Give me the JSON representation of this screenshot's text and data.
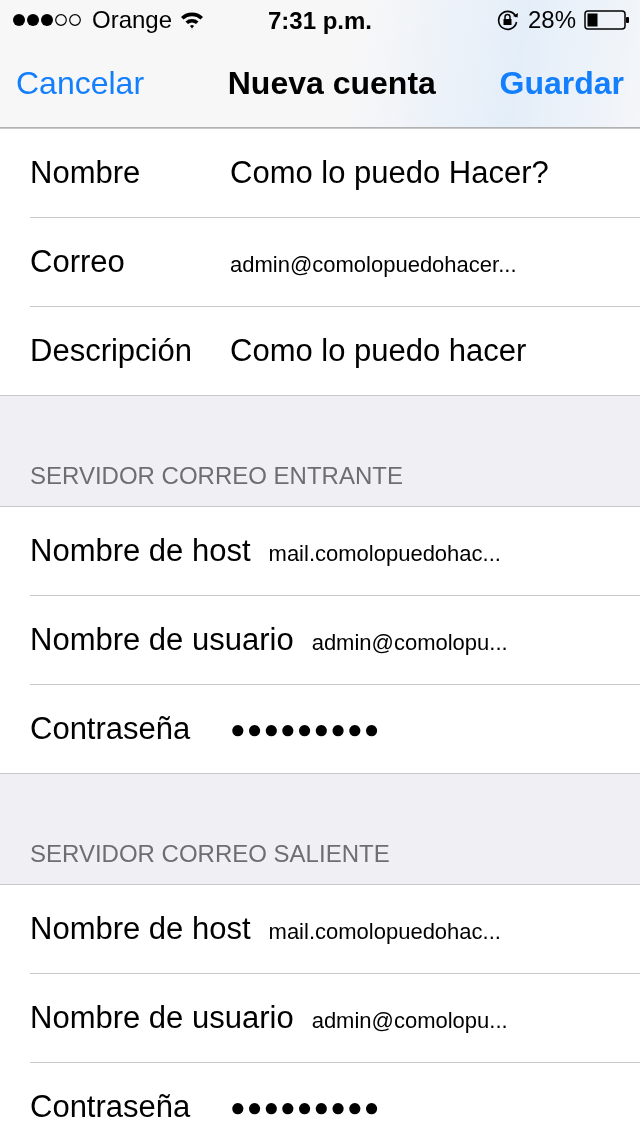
{
  "status_bar": {
    "carrier": "Orange",
    "time": "7:31 p.m.",
    "battery": "28%"
  },
  "nav": {
    "left": "Cancelar",
    "title": "Nueva cuenta",
    "right": "Guardar"
  },
  "sections": [
    {
      "rows": [
        {
          "label": "Nombre",
          "value": "Como lo puedo Hacer?",
          "kind": "text"
        },
        {
          "label": "Correo",
          "value": "admin@comolopuedohacer...",
          "kind": "long"
        },
        {
          "label": "Descripción",
          "value": "Como lo puedo hacer",
          "kind": "text"
        }
      ]
    },
    {
      "header": "SERVIDOR CORREO ENTRANTE",
      "rows": [
        {
          "label": "Nombre de host",
          "value": "mail.comolopuedohac...",
          "kind": "long"
        },
        {
          "label": "Nombre de usuario",
          "value": "admin@comolopu...",
          "kind": "long"
        },
        {
          "label": "Contraseña",
          "value": "●●●●●●●●●",
          "kind": "password"
        }
      ]
    },
    {
      "header": "SERVIDOR CORREO SALIENTE",
      "rows": [
        {
          "label": "Nombre de host",
          "value": "mail.comolopuedohac...",
          "kind": "long"
        },
        {
          "label": "Nombre de usuario",
          "value": "admin@comolopu...",
          "kind": "long"
        },
        {
          "label": "Contraseña",
          "value": "●●●●●●●●●",
          "kind": "password"
        }
      ]
    }
  ]
}
